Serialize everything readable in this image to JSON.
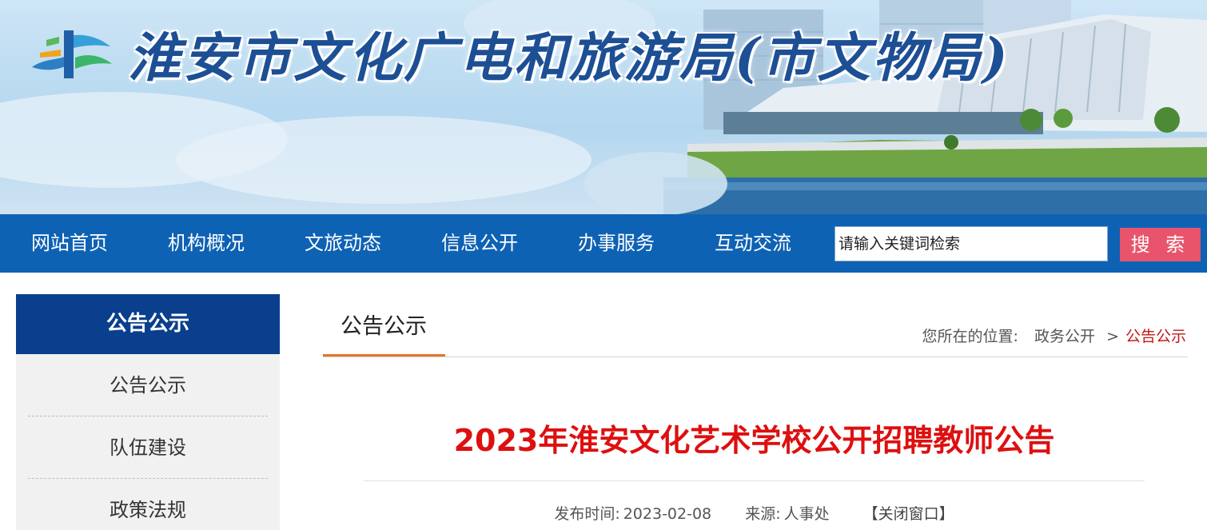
{
  "header": {
    "site_title": "淮安市文化广电和旅游局(市文物局)"
  },
  "nav": {
    "items": [
      {
        "label": "网站首页"
      },
      {
        "label": "机构概况"
      },
      {
        "label": "文旅动态"
      },
      {
        "label": "信息公开"
      },
      {
        "label": "办事服务"
      },
      {
        "label": "互动交流"
      }
    ],
    "search": {
      "placeholder": "请输入关键词检索",
      "button_label": "搜 索"
    }
  },
  "sidebar": {
    "title": "公告公示",
    "items": [
      {
        "label": "公告公示"
      },
      {
        "label": "队伍建设"
      },
      {
        "label": "政策法规"
      }
    ]
  },
  "main": {
    "tab": "公告公示",
    "breadcrumb": {
      "prefix": "您所在的位置:",
      "parent": "政务公开",
      "separator": ">",
      "current": "公告公示"
    },
    "article": {
      "title": "2023年淮安文化艺术学校公开招聘教师公告",
      "date_label": "发布时间:",
      "date": "2023-02-08",
      "source_label": "来源:",
      "source": "人事处",
      "close_label": "【关闭窗口】"
    }
  },
  "colors": {
    "nav_bg": "#0e62b4",
    "sidebar_head_bg": "#0a3f8d",
    "search_button": "#e8546c",
    "title_red": "#dd1010",
    "tab_underline": "#e8742a",
    "site_title_blue": "#1d4f95"
  }
}
